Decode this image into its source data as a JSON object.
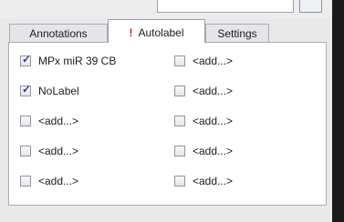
{
  "tabs": [
    {
      "label": "Annotations"
    },
    {
      "label": "Autolabel",
      "warning": "!"
    },
    {
      "label": "Settings"
    }
  ],
  "autolabel": {
    "left": [
      {
        "label": "MPx miR 39 CB",
        "checked": true
      },
      {
        "label": "NoLabel",
        "checked": true
      },
      {
        "label": "<add...>",
        "checked": false
      },
      {
        "label": "<add...>",
        "checked": false
      },
      {
        "label": "<add...>",
        "checked": false
      }
    ],
    "right": [
      {
        "label": "<add...>",
        "checked": false
      },
      {
        "label": "<add...>",
        "checked": false
      },
      {
        "label": "<add...>",
        "checked": false
      },
      {
        "label": "<add...>",
        "checked": false
      },
      {
        "label": "<add...>",
        "checked": false
      }
    ]
  }
}
